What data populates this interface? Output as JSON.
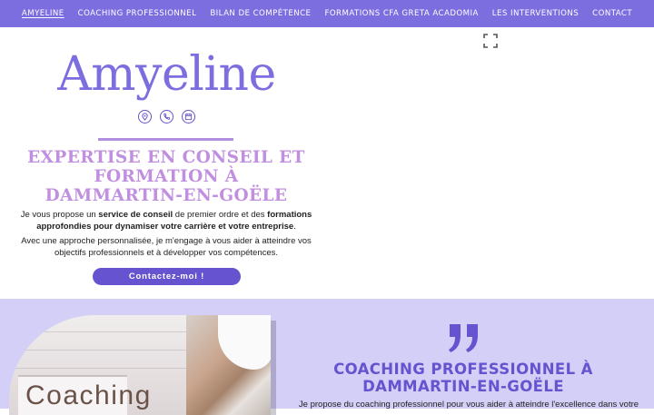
{
  "nav": {
    "items": [
      {
        "label": "AMYELINE",
        "active": true
      },
      {
        "label": "COACHING PROFESSIONNEL",
        "active": false
      },
      {
        "label": "BILAN DE COMPÉTENCE",
        "active": false
      },
      {
        "label": "FORMATIONS CFA GRETA ACADOMIA",
        "active": false
      },
      {
        "label": "LES INTERVENTIONS",
        "active": false
      },
      {
        "label": "CONTACT",
        "active": false
      }
    ]
  },
  "hero": {
    "brand": "Amyeline",
    "icons": [
      "location-icon",
      "phone-icon",
      "calendar-icon"
    ],
    "title": "EXPERTISE EN CONSEIL ET FORMATION À DAMMARTIN-EN-GOËLE",
    "intro_1_a": "Je vous propose un ",
    "intro_1_b": "service de conseil",
    "intro_1_c": " de premier ordre et des ",
    "intro_1_d": "formations approfondies pour dynamiser votre carrière et votre entreprise",
    "intro_1_e": ".",
    "intro_2": "Avec une approche personnalisée, je m'engage à vous aider à atteindre vos objectifs professionnels et à développer vos compétences.",
    "cta_label": "Contactez-moi !"
  },
  "coaching": {
    "image_text": "Coaching",
    "title": "COACHING PROFESSIONNEL À DAMMARTIN-EN-GOËLE",
    "text": "Je propose du coaching professionnel pour vous aider à atteindre l'excellence dans votre"
  },
  "colors": {
    "accent": "#7d6ee0",
    "accent_dark": "#6553cf",
    "title_lilac": "#c18fe0",
    "section_bg": "#d4cff7"
  }
}
